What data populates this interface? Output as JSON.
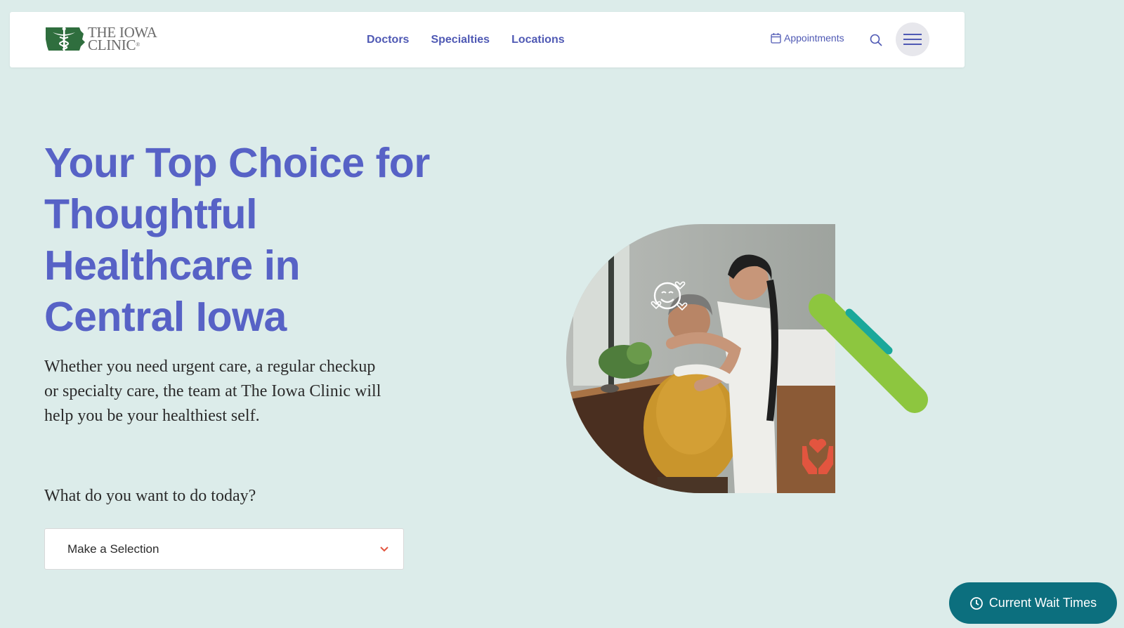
{
  "header": {
    "logo_line1": "THE IOWA",
    "logo_line2": "CLINIC",
    "logo_mark": "®",
    "nav": [
      "Doctors",
      "Specialties",
      "Locations"
    ],
    "appointments_label": "Appointments",
    "icons": {
      "calendar": "calendar-icon",
      "search": "search-icon",
      "menu": "hamburger-menu-icon"
    }
  },
  "hero": {
    "title": "Your Top Choice for Thoughtful Healthcare in Central Iowa",
    "description": "Whether you need urgent care, a regular checkup or specialty care, the team at The Iowa Clinic will help you be your healthiest self.",
    "question": "What do you want to do today?",
    "select_value": "Make a Selection"
  },
  "wait_times_label": "Current Wait Times",
  "colors": {
    "background": "#dcecea",
    "brand_purple": "#5762c6",
    "nav_text": "#4f59b4",
    "logo_green": "#2f6e3e",
    "wait_button": "#0c6f7e",
    "accent_green": "#8dc63f",
    "accent_teal": "#1aa89a",
    "accent_red": "#e2553f"
  }
}
